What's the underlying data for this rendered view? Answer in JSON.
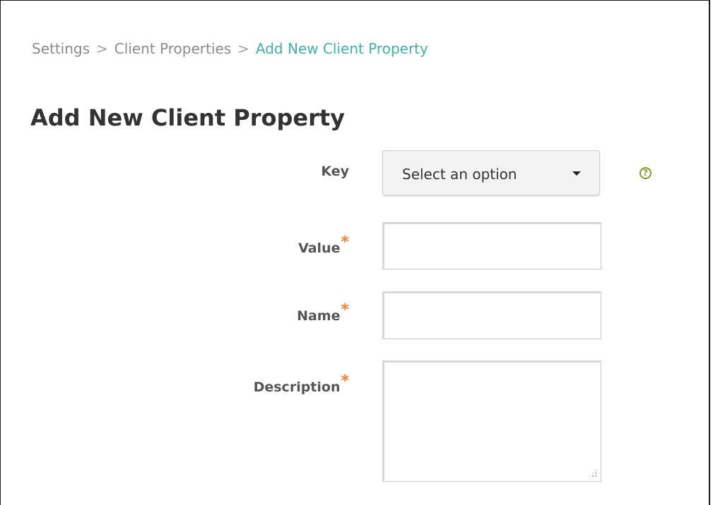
{
  "breadcrumb": {
    "items": [
      {
        "label": "Settings"
      },
      {
        "label": "Client Properties"
      },
      {
        "label": "Add New Client Property"
      }
    ],
    "separator": ">"
  },
  "page": {
    "title": "Add New Client Property"
  },
  "form": {
    "key": {
      "label": "Key",
      "selected": "Select an option"
    },
    "value": {
      "label": "Value",
      "required_mark": "*",
      "value": ""
    },
    "name": {
      "label": "Name",
      "required_mark": "*",
      "value": ""
    },
    "description": {
      "label": "Description",
      "required_mark": "*",
      "value": ""
    },
    "help_icon": "?"
  },
  "colors": {
    "breadcrumb_active": "#42b0a8",
    "required": "#f0823b",
    "help": "#7aa02c"
  }
}
